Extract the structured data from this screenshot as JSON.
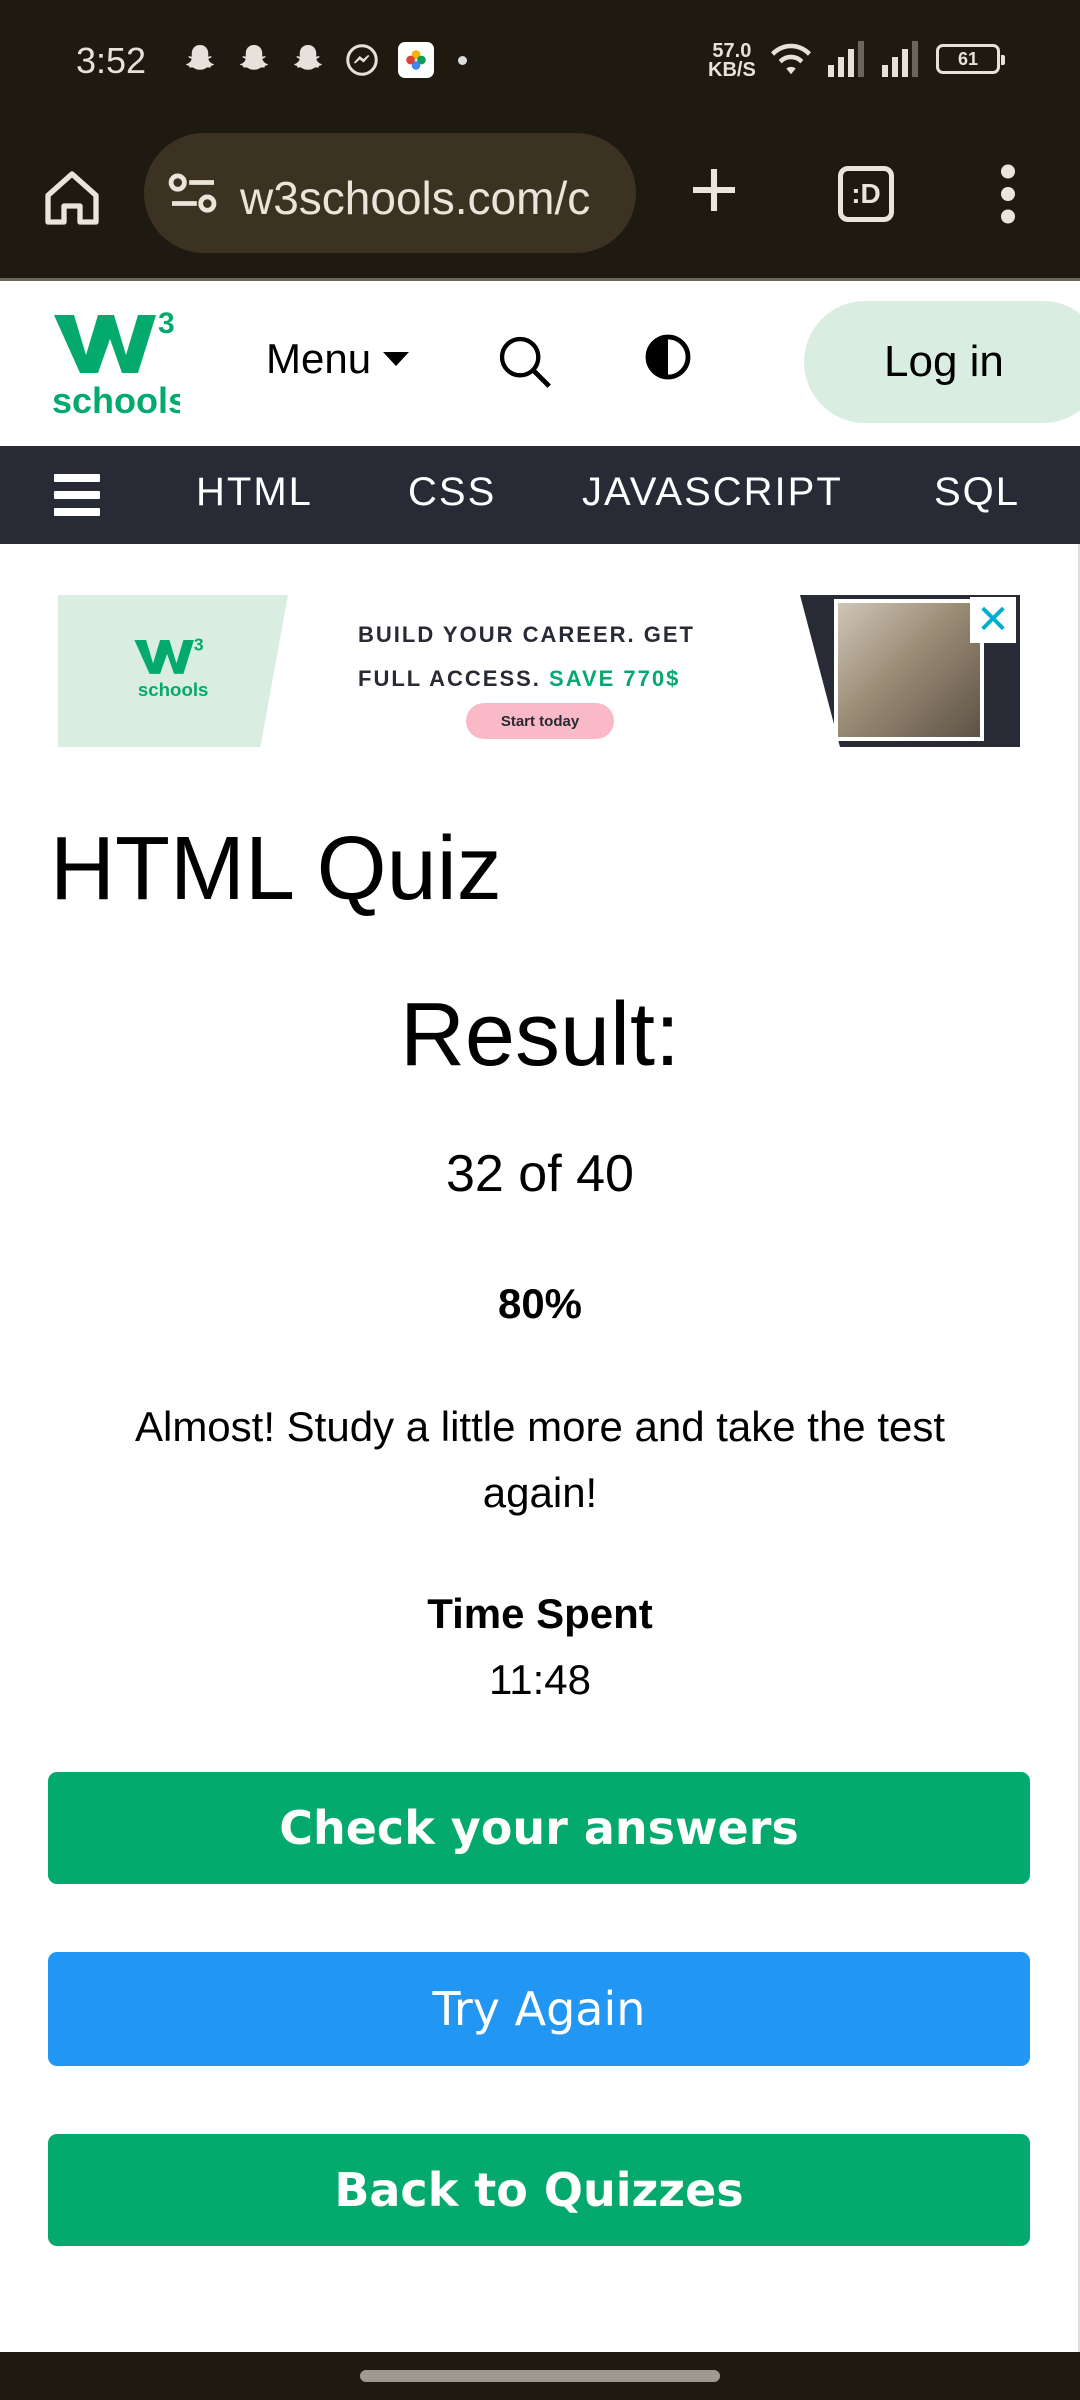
{
  "status_bar": {
    "time": "3:52",
    "net_speed_value": "57.0",
    "net_speed_unit": "KB/S",
    "battery": "61"
  },
  "browser": {
    "url": "w3schools.com/c",
    "tabs_label": ":D",
    "icons": [
      "home-icon",
      "site-info-icon",
      "new-tab-icon",
      "tab-switcher-icon",
      "more-icon"
    ]
  },
  "header": {
    "logo_text": "schools",
    "logo_superscript": "3",
    "menu_label": "Menu",
    "login_label": "Log in",
    "accent_color": "#04aa6d"
  },
  "nav": {
    "items": [
      "HTML",
      "CSS",
      "JAVASCRIPT",
      "SQL"
    ]
  },
  "ad": {
    "line1": "BUILD YOUR CAREER. GET",
    "line2_prefix": "FULL ACCESS.",
    "line2_highlight": "SAVE 770$",
    "cta": "Start today",
    "close": "✕"
  },
  "main": {
    "page_title": "HTML Quiz",
    "result_title": "Result:",
    "score": "32 of 40",
    "percent": "80%",
    "message": "Almost! Study a little more and take the test again!",
    "time_label": "Time Spent",
    "time_value": "11:48",
    "buttons": {
      "check": "Check your answers",
      "try_again": "Try Again",
      "back": "Back to Quizzes"
    },
    "colors": {
      "green": "#04aa6d",
      "blue": "#2196f3"
    }
  }
}
